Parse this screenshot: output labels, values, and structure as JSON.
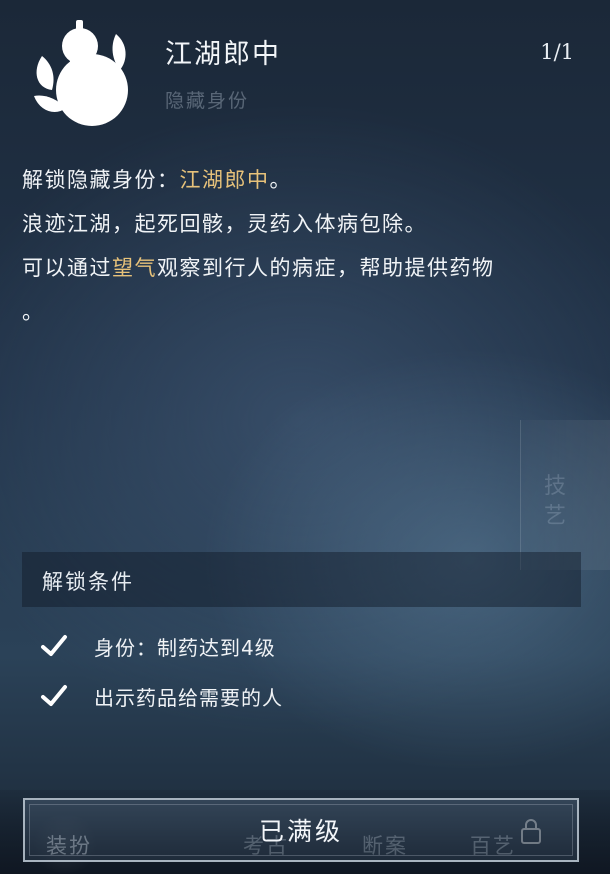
{
  "identity": {
    "title": "江湖郎中",
    "subtitle": "隐藏身份",
    "counter": "1/1",
    "icon": "gourd-icon"
  },
  "description": {
    "line1_prefix": "解锁隐藏身份：",
    "line1_highlight": "江湖郎中",
    "line1_suffix": "。",
    "line2": "浪迹江湖，起死回骸，灵药入体病包除。",
    "line3_prefix": "可以通过",
    "line3_highlight": "望气",
    "line3_suffix": "观察到行人的病症，帮助提供药物",
    "line4": "。"
  },
  "conditions": {
    "header": "解锁条件",
    "items": [
      {
        "text": "身份：制药达到4级",
        "done": true
      },
      {
        "text": "出示药品给需要的人",
        "done": true
      }
    ]
  },
  "button": {
    "label": "已满级"
  },
  "background": {
    "side_tab": "技艺",
    "bottom_tabs": [
      "装扮",
      "考古",
      "断案",
      "百艺"
    ]
  },
  "colors": {
    "highlight": "#e7c27a",
    "text": "#f0f3f6"
  }
}
